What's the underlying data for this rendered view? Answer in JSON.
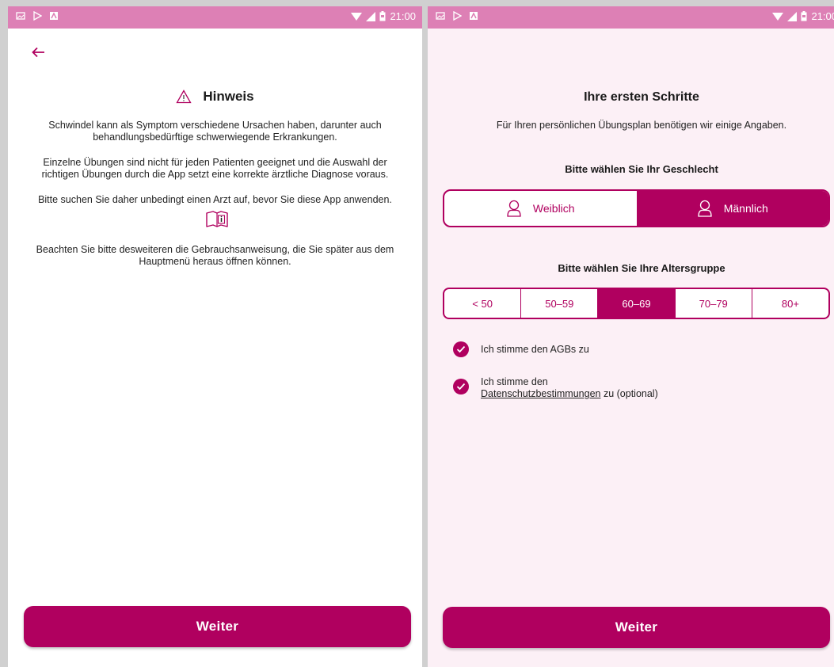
{
  "status_bar": {
    "time": "21:00"
  },
  "left_screen": {
    "title": "Hinweis",
    "paragraphs": [
      "Schwindel kann als Symptom verschiedene Ursachen haben, darunter auch behandlungsbedürftige schwerwiegende Erkrankungen.",
      "Einzelne Übungen sind nicht für jeden Patienten geeignet und die Auswahl der richtigen Übungen durch die App setzt eine korrekte ärztliche Diagnose voraus.",
      "Bitte suchen Sie daher unbedingt einen Arzt auf, bevor Sie diese App anwenden.",
      "Beachten Sie bitte desweiteren die Gebrauchsanweisung, die Sie später aus dem Hauptmenü heraus öffnen können."
    ],
    "button_label": "Weiter"
  },
  "right_screen": {
    "title": "Ihre ersten Schritte",
    "subtitle": "Für Ihren persönlichen Übungsplan benötigen wir einige Angaben.",
    "gender_label": "Bitte wählen Sie Ihr Geschlecht",
    "gender_options": [
      "Weiblich",
      "Männlich"
    ],
    "gender_selected": "Männlich",
    "age_label": "Bitte wählen Sie Ihre Altersgruppe",
    "age_options": [
      "< 50",
      "50–59",
      "60–69",
      "70–79",
      "80+"
    ],
    "age_selected": "60–69",
    "agb_text": "Ich stimme den AGBs zu",
    "privacy_prefix": "Ich stimme den",
    "privacy_link": "Datenschutzbestimmungen",
    "privacy_suffix": " zu (optional)",
    "button_label": "Weiter"
  },
  "colors": {
    "accent": "#b0005f",
    "status_bar": "#dd80b5",
    "right_background": "#fcf0f6"
  }
}
